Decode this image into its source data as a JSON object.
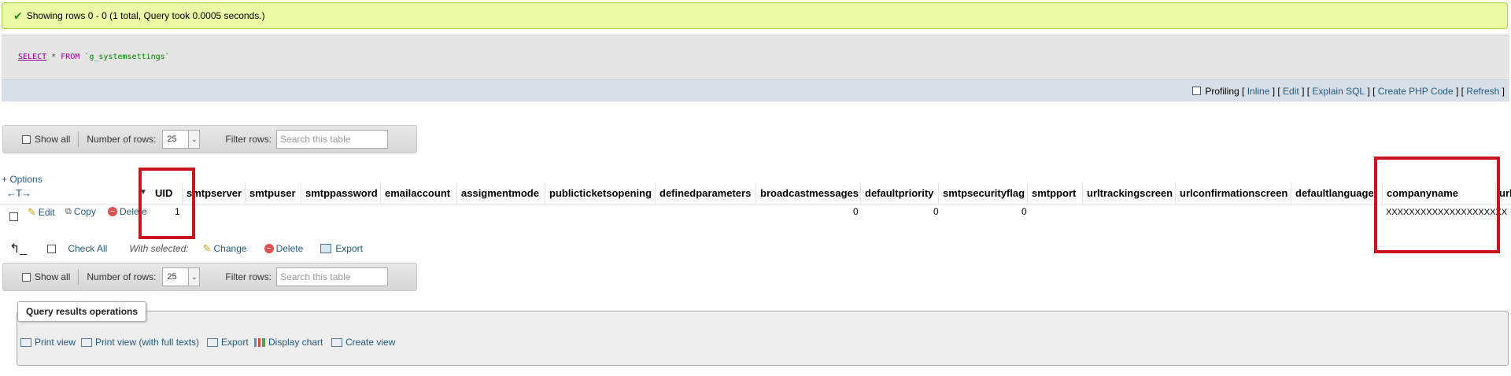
{
  "success": {
    "icon": "check-icon",
    "message": "Showing rows 0 - 0 (1 total, Query took 0.0005 seconds.)"
  },
  "sql": {
    "select": "SELECT",
    "star": "*",
    "from": "FROM",
    "table": "`g_systemsettings`"
  },
  "sql_toolbar": {
    "profiling": "Profiling",
    "links": [
      "Inline",
      "Edit",
      "Explain SQL",
      "Create PHP Code",
      "Refresh"
    ]
  },
  "nav": {
    "show_all": "Show all",
    "rows_label": "Number of rows:",
    "rows_value": "25",
    "filter_label": "Filter rows:",
    "filter_placeholder": "Search this table"
  },
  "options_label": "+ Options",
  "arrows": "←T→",
  "columns": [
    "UID",
    "smtpserver",
    "smtpuser",
    "smtppassword",
    "emailaccount",
    "assigmentmode",
    "publicticketsopening",
    "definedparameters",
    "broadcastmessages",
    "defaultpriority",
    "smtpsecurityflag",
    "smtpport",
    "urltrackingscreen",
    "urlconfirmationscreen",
    "defaultlanguage",
    "companyname",
    "urli"
  ],
  "row_actions": {
    "edit": "Edit",
    "copy": "Copy",
    "delete": "Delete"
  },
  "row": {
    "uid": "1",
    "broadcastmessages": "0",
    "defaultpriority": "0",
    "smtpsecurityflag": "0",
    "companyname": "XXXXXXXXXXXXXXXXXXXXX"
  },
  "with_selected": {
    "check_all": "Check All",
    "label": "With selected:",
    "change": "Change",
    "delete": "Delete",
    "export": "Export"
  },
  "query_ops": {
    "legend": "Query results operations",
    "items": [
      "Print view",
      "Print view (with full texts)",
      "Export",
      "Display chart",
      "Create view"
    ]
  },
  "colors": {
    "highlight": "#c8141c",
    "link": "#235a81",
    "success_bg": "#ebf8a4"
  }
}
